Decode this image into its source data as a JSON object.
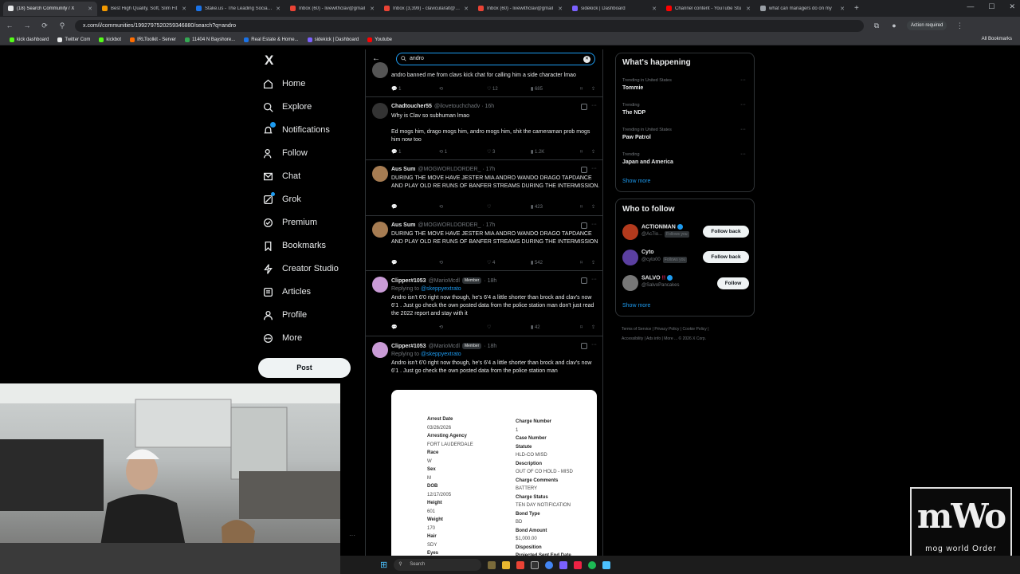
{
  "browser": {
    "tabs": [
      {
        "title": "(18) Search Community / X",
        "color": "#e7e9ea"
      },
      {
        "title": "Best High Quality, Soft, Slim Fit",
        "color": "#f29900"
      },
      {
        "title": "Stake.us - The Leading Social Ca",
        "color": "#1a73e8"
      },
      {
        "title": "Inbox (60) - livewithclav@gmail",
        "color": "#ea4335"
      },
      {
        "title": "Inbox (3,399) - clavicularalt@gm",
        "color": "#ea4335"
      },
      {
        "title": "Inbox (60) - livewithclav@gmail",
        "color": "#ea4335"
      },
      {
        "title": "sidekick | Dashboard",
        "color": "#7b61ff"
      },
      {
        "title": "Channel content - YouTube Stu",
        "color": "#ff0000"
      },
      {
        "title": "what can managers do on my",
        "color": "#9aa0a6"
      }
    ],
    "url": "x.com/i/communities/1992797520259346880/search?q=andro",
    "action_required": "Action required",
    "bookmarks": [
      {
        "label": "kick dashboard",
        "color": "#53fc18"
      },
      {
        "label": "Twitter Com",
        "color": "#e7e9ea"
      },
      {
        "label": "kickbot",
        "color": "#53fc18"
      },
      {
        "label": "IRLToolkit - Server",
        "color": "#ff6d00"
      },
      {
        "label": "11404 N Bayshore...",
        "color": "#34a853"
      },
      {
        "label": "Real Estate & Home...",
        "color": "#1a73e8"
      },
      {
        "label": "sidekick | Dashboard",
        "color": "#7b61ff"
      },
      {
        "label": "Youtube",
        "color": "#ff0000"
      }
    ],
    "all_bookmarks": "All Bookmarks"
  },
  "nav": {
    "logo": "X",
    "items": [
      "Home",
      "Explore",
      "Notifications",
      "Follow",
      "Chat",
      "Grok",
      "Premium",
      "Bookmarks",
      "Creator Studio",
      "Articles",
      "Profile",
      "More"
    ],
    "post": "Post"
  },
  "search": {
    "query": "andro"
  },
  "tweets": [
    {
      "text": "andro banned me from clavs kick chat for calling him a side character lmao",
      "reply": "1",
      "retweet": "",
      "like": "12",
      "views": "685"
    },
    {
      "name": "Chadtoucher55",
      "handle": "@ilovetouchchadv · 16h",
      "text": "Why is Clav so subhuman lmao\n\nEd mogs him, drago mogs him, andro mogs him, shit the cameraman prob mogs him now too",
      "reply": "1",
      "retweet": "1",
      "like": "3",
      "views": "1.2K"
    },
    {
      "name": "Aus Sum",
      "handle": "@MOGWORLDORDER_ · 17h",
      "text": "DURING THE MOVE HAVE JESTER MIA ANDRO WANDO DRAGO TAPDANCE AND PLAY OLD RE RUNS OF BANFER STREAMS DURING THE INTERMISSION.",
      "reply": "",
      "retweet": "",
      "like": "",
      "views": "423"
    },
    {
      "name": "Aus Sum",
      "handle": "@MOGWORLDORDER_ · 17h",
      "text": "DURING THE MOVE HAVE JESTER MIA ANDRO WANDO DRAGO TAPDANCE AND PLAY OLD RE RUNS OF BANFER STREAMS DURING THE INTERMISSION",
      "reply": "",
      "retweet": "",
      "like": "4",
      "views": "542"
    },
    {
      "name": "Clipper#1053",
      "handle": "@MarioMcdl",
      "badge": "Member",
      "time": "· 18h",
      "replying_label": "Replying to",
      "replying_to": "@skeppyextrato",
      "text": "Andro isn't 6'0 right now though, he's 6'4 a little shorter than brock and clav's now 6'1 . Just go check the own posted data from the police station man don't just read the 2022 report and stay with it",
      "reply": "",
      "retweet": "",
      "like": "",
      "views": "42"
    },
    {
      "name": "Clipper#1053",
      "handle": "@MarioMcdl",
      "badge": "Member",
      "time": "· 18h",
      "replying_label": "Replying to",
      "replying_to": "@skeppyextrato",
      "text": "Andro isn't 6'0 right now though, he's 6'4 a little shorter than brock and clav's now 6'1 . Just go check the own posted data from the police station man"
    }
  ],
  "document": {
    "left": [
      {
        "label": "Arrest Date",
        "value": "03/26/2026"
      },
      {
        "label": "Arresting Agency",
        "value": "FORT LAUDERDALE"
      },
      {
        "label": "Race",
        "value": "W"
      },
      {
        "label": "Sex",
        "value": "M"
      },
      {
        "label": "DOB",
        "value": "12/17/2005"
      },
      {
        "label": "Height",
        "value": "601"
      },
      {
        "label": "Weight",
        "value": "170"
      },
      {
        "label": "Hair",
        "value": "SDY"
      },
      {
        "label": "Eyes",
        "value": ""
      }
    ],
    "right": [
      {
        "label": "Charge Number",
        "value": "1"
      },
      {
        "label": "Case Number",
        "value": ""
      },
      {
        "label": "Statute",
        "value": "HLD-CO MISD"
      },
      {
        "label": "Description",
        "value": "OUT OF CO HOLD - MISD"
      },
      {
        "label": "Charge Comments",
        "value": "BATTERY"
      },
      {
        "label": "Charge Status",
        "value": "TEN DAY NOTIFICATION"
      },
      {
        "label": "Bond Type",
        "value": "BD"
      },
      {
        "label": "Bond Amount",
        "value": "$1,000.00"
      },
      {
        "label": "Disposition",
        "value": ""
      },
      {
        "label": "Projected Sent End Date",
        "value": ""
      }
    ]
  },
  "happening": {
    "title": "What's happening",
    "trends": [
      {
        "context": "Trending in United States",
        "name": "Tommie"
      },
      {
        "context": "Trending",
        "name": "The NDP"
      },
      {
        "context": "Trending in United States",
        "name": "Paw Patrol"
      },
      {
        "context": "Trending",
        "name": "Japan and America"
      }
    ],
    "show_more": "Show more"
  },
  "who_to_follow": {
    "title": "Who to follow",
    "users": [
      {
        "name": "ACTIONMAN",
        "handle": "@Ac7io...",
        "follows_you": "Follows you",
        "button": "Follow back",
        "color": "#b33a1d"
      },
      {
        "name": "Cyto",
        "handle": "@cyto00",
        "follows_you": "Follows you",
        "button": "Follow back",
        "color": "#5b3fa0"
      },
      {
        "name": "SALVO",
        "handle": "@SalvoPancakes",
        "follows_you": "",
        "button": "Follow",
        "color": "#777"
      }
    ],
    "show_more": "Show more"
  },
  "footer": {
    "links": [
      "Terms of Service",
      "Privacy Policy",
      "Cookie Policy",
      "Accessibility",
      "Ads info",
      "More ...",
      "© 2026 X Corp."
    ]
  },
  "taskbar": {
    "search": "Search"
  },
  "watermark": {
    "top": "mWo",
    "bottom": "mog world Order"
  }
}
